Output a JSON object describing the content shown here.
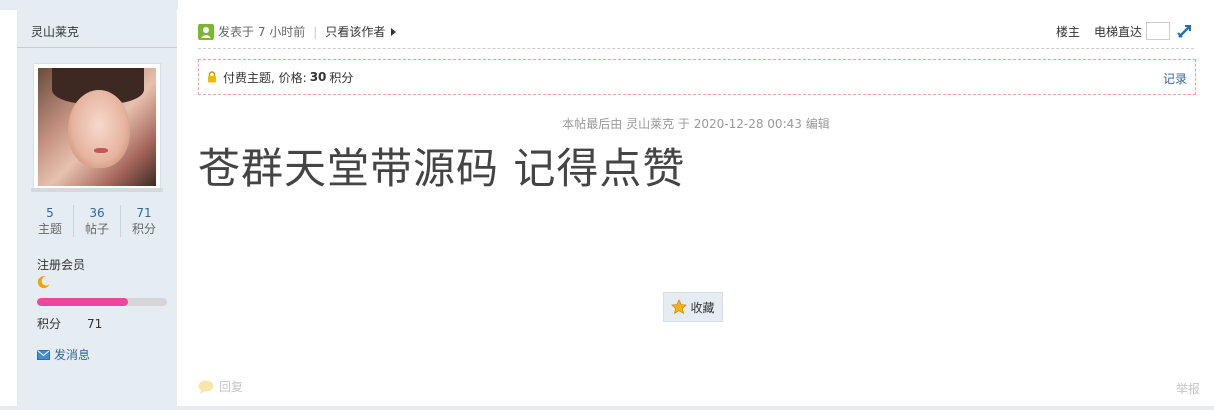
{
  "author": {
    "name": "灵山莱克",
    "stats": [
      {
        "value": "5",
        "label": "主题"
      },
      {
        "value": "36",
        "label": "帖子"
      },
      {
        "value": "71",
        "label": "积分"
      }
    ],
    "group": "注册会员",
    "level_progress_pct": 70,
    "score_label": "积分",
    "score_value": "71",
    "message_label": "发消息"
  },
  "post": {
    "posted_label": "发表于 7 小时前",
    "separator": "|",
    "only_author_label": "只看该作者",
    "floor_label": "楼主",
    "elevator_label": "电梯直达",
    "paid_text": "付费主题, 价格:",
    "price": "30",
    "price_unit": "积分",
    "record_label": "记录",
    "edit_note": "本帖最后由 灵山莱克 于 2020-12-28 00:43 编辑",
    "title": "苍群天堂带源码 记得点赞",
    "favorite_label": "收藏",
    "reply_label": "回复",
    "report_label": "举报"
  },
  "colors": {
    "sidebar_bg": "#e5edf2",
    "link": "#336699",
    "level_fill": "#e9489d",
    "paid_border": "#ff9a9a"
  },
  "icons": [
    "online-status-icon",
    "arrow-right-icon",
    "go-icon",
    "lock-icon",
    "moon-icon",
    "envelope-icon",
    "star-icon",
    "reply-bubble-icon"
  ]
}
